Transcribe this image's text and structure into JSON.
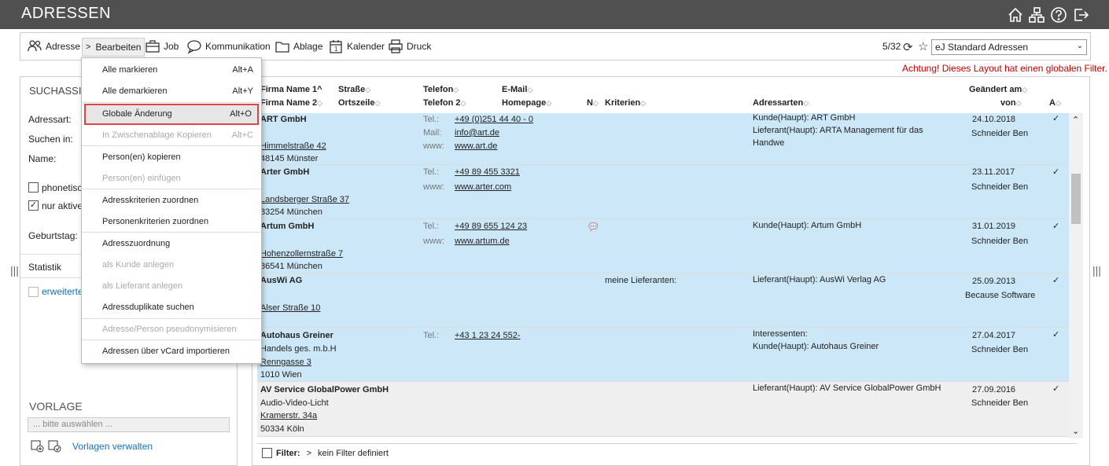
{
  "app": {
    "title": "ADRESSEN"
  },
  "toolbar": {
    "adresse": "Adresse",
    "bearbeiten": "Bearbeiten",
    "job": "Job",
    "kommunikation": "Kommunikation",
    "ablage": "Ablage",
    "kalender": "Kalender",
    "druck": "Druck",
    "counter": "5/32",
    "layout": "eJ Standard Adressen",
    "kalender_day": "1"
  },
  "warning": "Achtung! Dieses Layout hat einen globalen Filter.",
  "left": {
    "heading": "SUCHASSIS",
    "adressart": "Adressart:",
    "suchen_in": "Suchen in:",
    "name": "Name:",
    "phonetisch": "phonetisch",
    "nur_aktive": "nur aktive",
    "geburtstag": "Geburtstag:",
    "statistik": "Statistik",
    "erweitert": "erweiterte",
    "vorlage": "VORLAGE",
    "vorlage_placeholder": "... bitte auswählen ...",
    "vorlagen_verwalten": "Vorlagen verwalten"
  },
  "menu": {
    "items": [
      {
        "label": "Alle markieren",
        "key": "Alt+A"
      },
      {
        "label": "Alle demarkieren",
        "key": "Alt+Y"
      },
      {
        "label": "Globale Änderung",
        "key": "Alt+O"
      },
      {
        "label": "In Zwischenablage Kopieren",
        "key": "Alt+C"
      },
      {
        "label": "Person(en) kopieren",
        "key": ""
      },
      {
        "label": "Person(en) einfügen",
        "key": ""
      },
      {
        "label": "Adresskriterien zuordnen",
        "key": ""
      },
      {
        "label": "Personenkriterien zuordnen",
        "key": ""
      },
      {
        "label": "Adresszuordnung",
        "key": ""
      },
      {
        "label": "als Kunde anlegen",
        "key": ""
      },
      {
        "label": "als Lieferant anlegen",
        "key": ""
      },
      {
        "label": "Adressduplikate suchen",
        "key": ""
      },
      {
        "label": "Adresse/Person pseudonymisieren",
        "key": ""
      },
      {
        "label": "Adressen über vCard importieren",
        "key": ""
      }
    ]
  },
  "table": {
    "headers": {
      "firma1": "Firma Name 1^",
      "firma2": "Firma Name 2",
      "strasse": "Straße",
      "ortszeile": "Ortszeile",
      "telefon": "Telefon",
      "telefon2": "Telefon 2",
      "email": "E-Mail",
      "homepage": "Homepage",
      "n": "N",
      "kriterien": "Kriterien",
      "adressarten": "Adressarten",
      "geaendert": "Geändert am",
      "von": "von",
      "a": "A"
    },
    "labels": {
      "tel": "Tel.:",
      "mail": "Mail:",
      "www": "www:"
    },
    "rows": [
      {
        "firma": "ART GmbH",
        "firma2": "",
        "strasse": "Himmelstraße 42",
        "ort": "48145 Münster",
        "tel": "+49 (0)251 44 40 - 0",
        "mail": "info@art.de",
        "www": "www.art.de",
        "kriterien": "",
        "arten1": "Kunde(Haupt): ART GmbH",
        "arten2": "Lieferant(Haupt): ARTA Management für das",
        "arten3": "Handwe",
        "datum": "24.10.2018",
        "von": "Schneider Ben",
        "check": "✓"
      },
      {
        "firma": "Arter GmbH",
        "firma2": "",
        "strasse": "Landsberger Straße 37",
        "ort": "83254 München",
        "tel": "+49 89 455 3321",
        "mail": "",
        "www": "www.arter.com",
        "kriterien": "",
        "arten1": "",
        "arten2": "",
        "arten3": "",
        "datum": "23.11.2017",
        "von": "Schneider Ben",
        "check": "✓"
      },
      {
        "firma": "Artum GmbH",
        "firma2": "",
        "strasse": "Hohenzollernstraße 7",
        "ort": "86541 München",
        "tel": "+49 89 655 124 23",
        "mail": "",
        "www": "www.artum.de",
        "kriterien": "",
        "arten1": "Kunde(Haupt): Artum GmbH",
        "arten2": "",
        "arten3": "",
        "datum": "31.01.2019",
        "von": "Schneider Ben",
        "check": "✓"
      },
      {
        "firma": "AusWi AG",
        "firma2": "",
        "strasse": "Alser Straße 10",
        "ort": "",
        "tel": "",
        "mail": "",
        "www": "",
        "kriterien": "meine Lieferanten:",
        "arten1": "Lieferant(Haupt): AusWi Verlag AG",
        "arten2": "",
        "arten3": "",
        "datum": "25.09.2013",
        "von": "Because Software",
        "check": "✓"
      },
      {
        "firma": "Autohaus Greiner",
        "firma2": "Handels ges. m.b.H",
        "strasse": "Renngasse 3",
        "ort": "1010 Wien",
        "tel": "+43 1 23 24 552-",
        "mail": "",
        "www": "",
        "kriterien": "",
        "arten1": "Interessenten:",
        "arten2": "Kunde(Haupt): Autohaus Greiner",
        "arten3": "",
        "datum": "27.04.2017",
        "von": "Schneider Ben",
        "check": "✓"
      },
      {
        "firma": "AV Service GlobalPower GmbH",
        "firma2": "Audio-Video-Licht",
        "strasse": "Kramerstr. 34a",
        "ort": "50334 Köln",
        "tel": "",
        "mail": "",
        "www": "",
        "kriterien": "",
        "arten1": "Lieferant(Haupt): AV Service GlobalPower GmbH",
        "arten2": "",
        "arten3": "",
        "datum": "27.09.2016",
        "von": "Schneider Ben",
        "check": "✓"
      }
    ]
  },
  "filter": {
    "label": "Filter:",
    "value": "kein Filter definiert"
  },
  "colors": {
    "titlebar": "#505050",
    "row_selected": "#cce8f8",
    "row_normal": "#efefef",
    "warning": "#c00000",
    "menu_highlight_border": "#e0443e",
    "link": "#1a6fb5"
  }
}
